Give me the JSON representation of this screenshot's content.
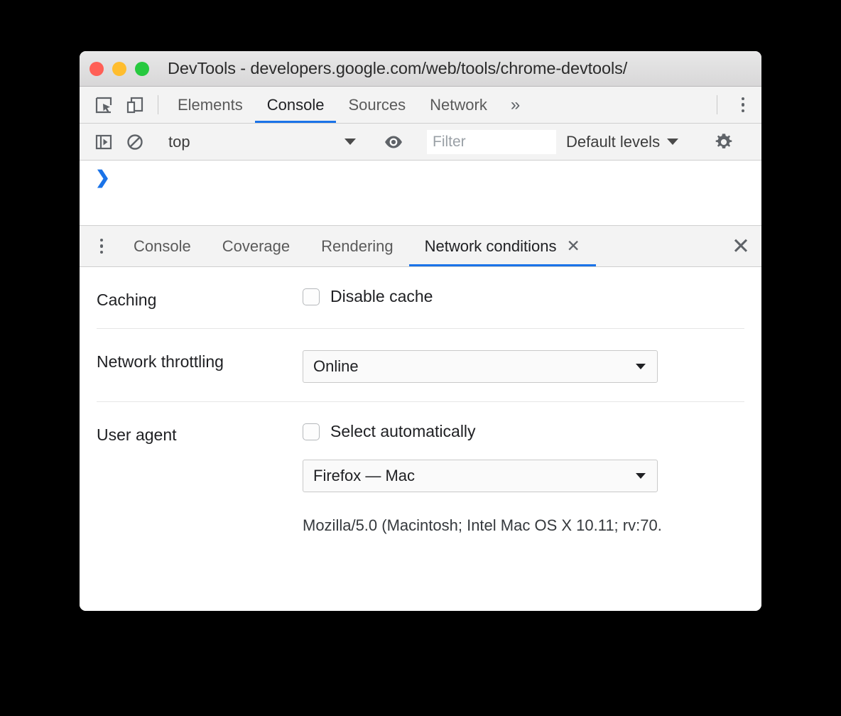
{
  "window": {
    "title": "DevTools - developers.google.com/web/tools/chrome-devtools/",
    "traffic_lights": {
      "close_color": "#ff5f56",
      "minimize_color": "#ffbd2e",
      "maximize_color": "#27c93f"
    }
  },
  "main_toolbar": {
    "inspect_icon": "inspect-element-icon",
    "device_icon": "device-toolbar-icon",
    "overflow_label": "»",
    "menu_icon": "kebab-menu-icon",
    "tabs": [
      {
        "label": "Elements",
        "active": false
      },
      {
        "label": "Console",
        "active": true
      },
      {
        "label": "Sources",
        "active": false
      },
      {
        "label": "Network",
        "active": false
      }
    ],
    "active_underline_color": "#1a73e8"
  },
  "console_toolbar": {
    "sidebar_toggle_icon": "console-sidebar-toggle-icon",
    "clear_icon": "clear-console-icon",
    "context_value": "top",
    "eye_icon": "live-expression-eye-icon",
    "filter_placeholder": "Filter",
    "filter_value": "",
    "levels_value": "Default levels",
    "settings_icon": "gear-icon"
  },
  "console_output": {
    "prompt_symbol": "❯",
    "prompt_color": "#1a73e8"
  },
  "drawer": {
    "menu_icon": "kebab-menu-icon",
    "close_icon": "close-icon",
    "tabs": [
      {
        "label": "Console",
        "active": false,
        "closeable": false
      },
      {
        "label": "Coverage",
        "active": false,
        "closeable": false
      },
      {
        "label": "Rendering",
        "active": false,
        "closeable": false
      },
      {
        "label": "Network conditions",
        "active": true,
        "closeable": true,
        "close_symbol": "✕"
      }
    ],
    "close_symbol": "✕"
  },
  "network_conditions": {
    "caching": {
      "label": "Caching",
      "disable_cache_label": "Disable cache",
      "disable_cache_checked": false
    },
    "throttling": {
      "label": "Network throttling",
      "value": "Online"
    },
    "user_agent": {
      "label": "User agent",
      "select_automatically_label": "Select automatically",
      "select_automatically_checked": false,
      "value": "Firefox — Mac",
      "ua_string": "Mozilla/5.0 (Macintosh; Intel Mac OS X 10.11; rv:70."
    }
  }
}
